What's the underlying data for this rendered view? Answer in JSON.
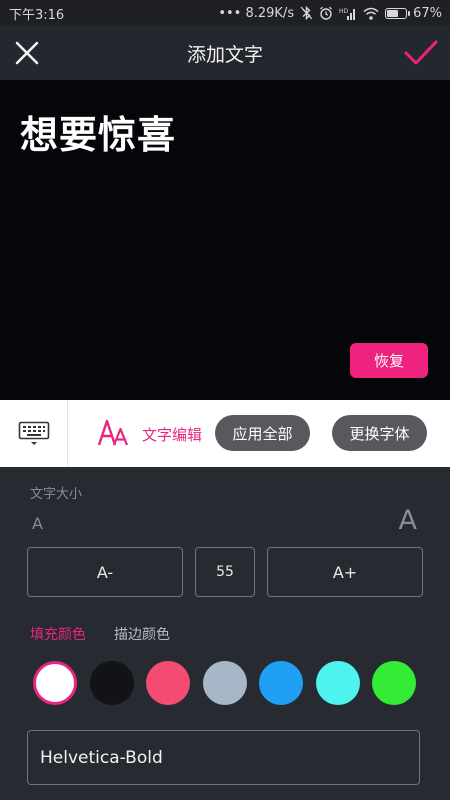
{
  "status_bar": {
    "time": "下午3:16",
    "network_speed": "••• 8.29K/s",
    "battery_percent": "67%",
    "battery_level": 0.67
  },
  "header": {
    "title": "添加文字"
  },
  "preview": {
    "text": "想要惊喜",
    "restore_label": "恢复"
  },
  "toolbar": {
    "edit_label": "文字编辑",
    "apply_all_label": "应用全部",
    "change_font_label": "更换字体"
  },
  "text_size": {
    "title": "文字大小",
    "small_glyph": "A",
    "large_glyph": "A",
    "decrease_label": "A-",
    "value": "55",
    "increase_label": "A+"
  },
  "color_tabs": {
    "fill_label": "填充颜色",
    "stroke_label": "描边颜色"
  },
  "colors": {
    "accent": "#f0227f",
    "swatches": [
      "#ffffff",
      "#111317",
      "#f44b73",
      "#a6b8c8",
      "#1fa0f5",
      "#4ef3ef",
      "#34eb35"
    ],
    "selected_index": 0
  },
  "font": {
    "current": "Helvetica-Bold"
  }
}
